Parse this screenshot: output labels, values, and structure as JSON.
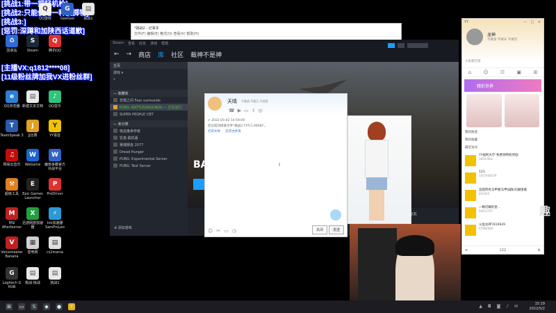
{
  "overlay": {
    "line1": "[挑战1:带一把轻机枪]",
    "line2": "[挑战2:只能使用一种投掷物]",
    "line3": "[挑战3:]",
    "line4": "[惩罚:深蹲和加陕西话道歉]",
    "line5": "[主播VX:q1812****08]",
    "line6": "[11级粉丝牌加我VX进粉丝群]"
  },
  "desktop_icons": [
    {
      "label": "回收站",
      "icon": "recycle-bin-icon",
      "color": "#2d6bd6"
    },
    {
      "label": "Steam",
      "icon": "steam-icon",
      "color": "#1b2838"
    },
    {
      "label": "腾讯QQ",
      "icon": "qq-icon",
      "color": "#e03030"
    },
    {
      "label": "QQ浏览器",
      "icon": "qq-browser-icon",
      "color": "#2a7fd6"
    },
    {
      "label": "新建文本文档",
      "icon": "text-doc-icon",
      "color": "#e8e8e8"
    },
    {
      "label": "QQ音乐",
      "icon": "qq-music-icon",
      "color": "#31c27c"
    },
    {
      "label": "TeamSpeak 3",
      "icon": "teamspeak-icon",
      "color": "#2b5aa8"
    },
    {
      "label": "JJ比赛",
      "icon": "jj-icon",
      "color": "#e0a020"
    },
    {
      "label": "YY语音",
      "icon": "yy-icon",
      "color": "#f2c200"
    },
    {
      "label": "网易云音乐",
      "icon": "netease-music-icon",
      "color": "#c20c0c"
    },
    {
      "label": "WeGame",
      "icon": "wegame-icon",
      "color": "#1a66d0"
    },
    {
      "label": "魔兽争霸官方对战平台",
      "icon": "warcraft-icon",
      "color": "#2f63c8"
    },
    {
      "label": "超级工具",
      "icon": "tool-icon",
      "color": "#e08020"
    },
    {
      "label": "Epic Games Launcher",
      "icon": "epic-icon",
      "color": "#222222"
    },
    {
      "label": "ProDriver",
      "icon": "prodriver-icon",
      "color": "#e03030"
    },
    {
      "label": "MSI Afterburner",
      "icon": "msi-icon",
      "color": "#c02020"
    },
    {
      "label": "迅游网游加速器",
      "icon": "xunyou-icon",
      "color": "#20a040"
    },
    {
      "label": "Ink加速器 SamProLeo",
      "icon": "accelerator-icon",
      "color": "#2a9ad6"
    },
    {
      "label": "Voicemeeter Banana",
      "icon": "voicemeeter-icon",
      "color": "#c02020"
    },
    {
      "label": "雷电网",
      "icon": "thunder-icon",
      "color": "#d0d0d0"
    },
    {
      "label": "cs2mania",
      "icon": "cs2mania-icon",
      "color": "#e0e0e0"
    },
    {
      "label": "Logitech G HUB",
      "icon": "logitech-icon",
      "color": "#333333"
    },
    {
      "label": "挑战-挑战",
      "icon": "doc-icon",
      "color": "#e8e8e8"
    },
    {
      "label": "挑战1",
      "icon": "doc-icon-2",
      "color": "#e8e8e8"
    }
  ],
  "top_icons": [
    {
      "label": "QQ游戏",
      "icon": "qq-game-icon",
      "color": "#f0f0f0"
    },
    {
      "label": "GeeGee",
      "icon": "geegee-icon",
      "color": "#3060c8"
    },
    {
      "label": "挑战1",
      "icon": "doc-top-icon",
      "color": "#e8e8e8"
    }
  ],
  "notepad": {
    "title": "*挑战2 - 记事本",
    "menu": "文件(F)  编辑(E)  格式(O)  查看(V)  帮助(H)"
  },
  "steam": {
    "top_menu": [
      "Steam",
      "查看",
      "好友",
      "游戏",
      "帮助"
    ],
    "nav": [
      "商店",
      "库",
      "社区",
      "裁神不是神"
    ],
    "home": "主页",
    "games_label": "游戏",
    "favorites_header": "— 收藏夹",
    "favorites": [
      {
        "name": "恐惧之间 Fear surrounds",
        "state": ""
      },
      {
        "name": "PUBG: BATTLEGROUNDS — 正在运行",
        "state": "running"
      },
      {
        "name": "SUPER PEOPLE CBT",
        "state": ""
      }
    ],
    "uncategorized_header": "— 未分类",
    "uncategorized": [
      "吸血鬼幸存者",
      "饥荒:联机版",
      "赛博朋克 2077",
      "Dread Hunger",
      "PUBG: Experimental Server",
      "PUBG: Test Server"
    ],
    "hero_logo": "BA",
    "download_text": "好友聊天",
    "add_game": "添加游戏"
  },
  "chat": {
    "name": "天晴",
    "status": "不要烦 不要天 不经营",
    "timestamp": "2022-05-02 14:59:09",
    "message": "您已成功接收文件\"挑战2.TXT(1.06KB)\"。",
    "link_open": "打开文件",
    "link_folder": "打开文件夹",
    "close_label": "关闭",
    "send_label": "发送"
  },
  "yy": {
    "title": "YY",
    "window_controls": "— □ ×",
    "name": "龙神",
    "signature": "不要烦 不要天 不要可",
    "search_placeholder": "大家都在搜",
    "banner": "精彩世界",
    "menu_items": [
      "YY福利大厅-免费领特权奖励",
      "我的频道",
      "我的收藏",
      "最近访问"
    ],
    "channels": [
      {
        "title": "YY福利大厅-免费领特权奖励",
        "sub": "3859.90w"
      },
      {
        "title": "123",
        "sub": "1457448379"
      },
      {
        "title": "追猎所有马甲看马甲加群/刘群接邀",
        "sub": "816445"
      },
      {
        "title": "一颗闪耀的星…",
        "sub": "90415707"
      },
      {
        "title": "斗鱼龙神7819929",
        "sub": "07904666"
      }
    ],
    "footer_count": "122"
  },
  "taskbar": {
    "time": "15:19",
    "date": "2022/5/2"
  },
  "watermark": "趣"
}
